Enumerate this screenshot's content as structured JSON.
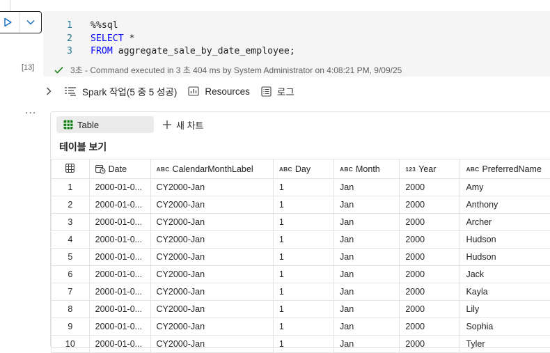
{
  "exec_count": "[13]",
  "code": {
    "lines": [
      {
        "num": "1",
        "text": "%%sql",
        "keyword": ""
      },
      {
        "num": "2",
        "text": " *",
        "keyword": "SELECT"
      },
      {
        "num": "3",
        "text": " aggregate_sale_by_date_employee;",
        "keyword": "FROM"
      }
    ]
  },
  "status_text": "3초 - Command executed in 3 초 404 ms by System Administrator on 4:08:21 PM, 9/09/25",
  "jobs": {
    "spark_label": "Spark 작업(5 중 5 성공)",
    "resources_label": "Resources",
    "log_label": "로그"
  },
  "more_label": "...",
  "tabs": {
    "table_label": "Table",
    "chart_label": "새 차트"
  },
  "view_title": "테이블 보기",
  "columns": [
    {
      "name": "Date",
      "type": "date"
    },
    {
      "name": "CalendarMonthLabel",
      "type": "ABC"
    },
    {
      "name": "Day",
      "type": "ABC"
    },
    {
      "name": "Month",
      "type": "ABC"
    },
    {
      "name": "Year",
      "type": "123"
    },
    {
      "name": "PreferredName",
      "type": "ABC"
    }
  ],
  "rows": [
    [
      "1",
      "2000-01-0...",
      "CY2000-Jan",
      "1",
      "Jan",
      "2000",
      "Amy"
    ],
    [
      "2",
      "2000-01-0...",
      "CY2000-Jan",
      "1",
      "Jan",
      "2000",
      "Anthony"
    ],
    [
      "3",
      "2000-01-0...",
      "CY2000-Jan",
      "1",
      "Jan",
      "2000",
      "Archer"
    ],
    [
      "4",
      "2000-01-0...",
      "CY2000-Jan",
      "1",
      "Jan",
      "2000",
      "Hudson"
    ],
    [
      "5",
      "2000-01-0...",
      "CY2000-Jan",
      "1",
      "Jan",
      "2000",
      "Hudson"
    ],
    [
      "6",
      "2000-01-0...",
      "CY2000-Jan",
      "1",
      "Jan",
      "2000",
      "Jack"
    ],
    [
      "7",
      "2000-01-0...",
      "CY2000-Jan",
      "1",
      "Jan",
      "2000",
      "Kayla"
    ],
    [
      "8",
      "2000-01-0...",
      "CY2000-Jan",
      "1",
      "Jan",
      "2000",
      "Lily"
    ],
    [
      "9",
      "2000-01-0...",
      "CY2000-Jan",
      "1",
      "Jan",
      "2000",
      "Sophia"
    ],
    [
      "10",
      "2000-01-0...",
      "CY2000-Jan",
      "1",
      "Jan",
      "2000",
      "Tyler"
    ]
  ],
  "colors": {
    "accent": "#0f6cbd",
    "success": "#107c10",
    "keyword": "#0000ff",
    "line_number": "#237893"
  }
}
